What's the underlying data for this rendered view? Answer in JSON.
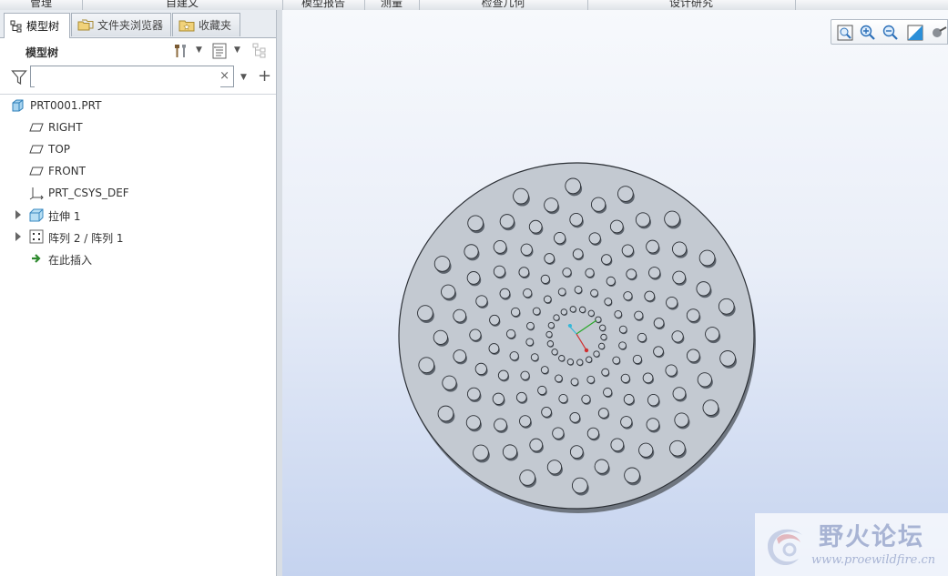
{
  "ribbon": {
    "tabs": [
      "管理",
      "自建文",
      "模型报告",
      "测量",
      "检查几何",
      "设计研究"
    ]
  },
  "navigator": {
    "tabs": [
      {
        "label": "模型树",
        "active": true
      },
      {
        "label": "文件夹浏览器",
        "active": false
      },
      {
        "label": "收藏夹",
        "active": false
      }
    ],
    "tree_title": "模型树",
    "search": {
      "value": "",
      "placeholder": ""
    },
    "clear_symbol": "×",
    "add_symbol": "+",
    "items": [
      {
        "label": "PRT0001.PRT",
        "icon": "part-icon",
        "expandable": false
      },
      {
        "label": "RIGHT",
        "icon": "datum-plane-icon",
        "expandable": false
      },
      {
        "label": "TOP",
        "icon": "datum-plane-icon",
        "expandable": false
      },
      {
        "label": "FRONT",
        "icon": "datum-plane-icon",
        "expandable": false
      },
      {
        "label": "PRT_CSYS_DEF",
        "icon": "coordinate-system-icon",
        "expandable": false
      },
      {
        "label": "拉伸 1",
        "icon": "extrude-icon",
        "expandable": true
      },
      {
        "label": "阵列 2 / 阵列 1",
        "icon": "pattern-icon",
        "expandable": true
      },
      {
        "label": "在此插入",
        "icon": "insert-here-arrow-icon",
        "expandable": false
      }
    ]
  },
  "view_toolbar": {
    "icons": [
      "refit-icon",
      "zoom-in-icon",
      "zoom-out-icon",
      "repaint-icon",
      "display-style-icon"
    ]
  },
  "model": {
    "disc_color": "#c3c9d1",
    "bump_color": "#c8ced6",
    "spiral_arms": 18,
    "rings": 8
  },
  "watermark": {
    "text": "野火论坛",
    "url": "www.proewildfire.cn"
  }
}
